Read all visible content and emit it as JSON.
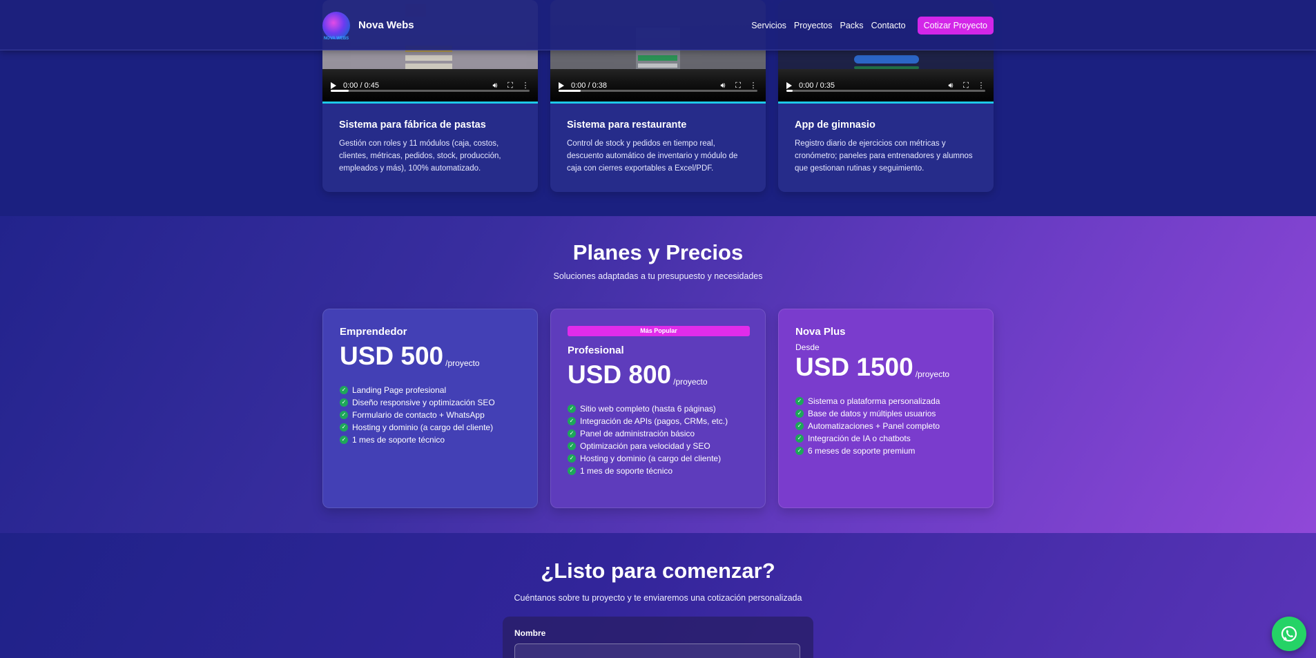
{
  "header": {
    "brand_name": "Nova Webs",
    "logo_text": "NOVA WEBS",
    "nav": [
      "Servicios",
      "Proyectos",
      "Packs",
      "Contacto"
    ],
    "cta": "Cotizar Proyecto"
  },
  "projects": [
    {
      "time": "0:00 / 0:45",
      "progress": 0.09,
      "title": "Sistema para fábrica de pastas",
      "description": "Gestión con roles y 11 módulos (caja, costos, clientes, métricas, pedidos, stock, producción, empleados y más), 100% automatizado."
    },
    {
      "time": "0:00 / 0:38",
      "progress": 0.11,
      "title": "Sistema para restaurante",
      "description": "Control de stock y pedidos en tiempo real, descuento automático de inventario y módulo de caja con cierres exportables a Excel/PDF."
    },
    {
      "time": "0:00 / 0:35",
      "progress": 0.03,
      "title": "App de gimnasio",
      "description": "Registro diario de ejercicios con métricas y cronómetro; paneles para entrenadores y alumnos que gestionan rutinas y seguimiento."
    }
  ],
  "pricing": {
    "title": "Planes y Precios",
    "subtitle": "Soluciones adaptadas a tu presupuesto y necesidades",
    "plans": [
      {
        "name": "Emprendedor",
        "price": "USD 500",
        "per": "/proyecto",
        "features": [
          "Landing Page profesional",
          "Diseño responsive y optimización SEO",
          "Formulario de contacto + WhatsApp",
          "Hosting y dominio (a cargo del cliente)",
          "1 mes de soporte técnico"
        ]
      },
      {
        "badge": "Más Popular",
        "name": "Profesional",
        "price": "USD 800",
        "per": "/proyecto",
        "features": [
          "Sitio web completo (hasta 6 páginas)",
          "Integración de APIs (pagos, CRMs, etc.)",
          "Panel de administración básico",
          "Optimización para velocidad y SEO",
          "Hosting y dominio (a cargo del cliente)",
          "1 mes de soporte técnico"
        ]
      },
      {
        "name": "Nova Plus",
        "from": "Desde",
        "price": "USD 1500",
        "per": "/proyecto",
        "features": [
          "Sistema o plataforma personalizada",
          "Base de datos y múltiples usuarios",
          "Automatizaciones + Panel completo",
          "Integración de IA o chatbots",
          "6 meses de soporte premium"
        ]
      }
    ]
  },
  "contact": {
    "title": "¿Listo para comenzar?",
    "subtitle": "Cuéntanos sobre tu proyecto y te enviaremos una cotización personalizada",
    "name_label": "Nombre"
  },
  "colors": {
    "accent": "#d326e8",
    "check": "#1ea75a",
    "whatsapp": "#25d366",
    "video_border": "#1ec9e8"
  },
  "icons": [
    "play-icon",
    "volume-icon",
    "fullscreen-icon",
    "more-options-icon",
    "check-icon",
    "whatsapp-icon"
  ]
}
